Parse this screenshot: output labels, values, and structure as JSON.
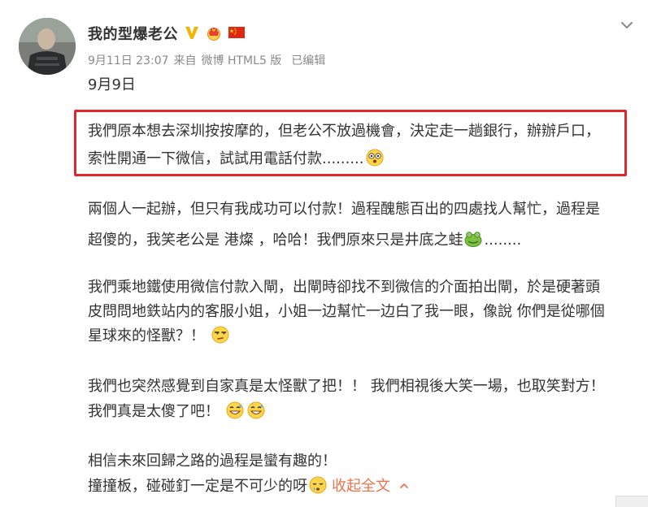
{
  "post": {
    "author": "我的型爆老公",
    "meta": {
      "timestamp": "9月11日 23:07",
      "source_prefix": "来自",
      "source": "微博 HTML5 版",
      "edited": "已编辑"
    },
    "paragraphs": [
      "9月9日",
      "我們原本想去深圳按按摩的，但老公不放過機會，決定走一趟銀行，辦辦戶口，",
      "索性開通一下微信，試試用電話付款.........",
      "兩個人一起辦，但只有我成功可以付款！過程醜態百出的四處找人幫忙，過程是",
      "超傻的，我笑老公是 港燦 ，哈哈！我們原來只是井底之蛙",
      "........",
      "我們乘地鐵使用微信付款入閘，出閘時卻找不到微信的介面拍出閘，於是硬著頭",
      "皮問問地鉄站内的客服小姐，小姐一边幫忙一边白了我一眼，像說 你們是從哪個",
      "星球來的怪獸？！",
      "我們也突然感覺到自家真是太怪獸了把！！ 我們相視後大笑一場，也取笑對方！",
      "我們真是太傻了吧！",
      "相信未來回歸之路的過程是蠻有趣的！",
      "撞撞板，碰碰釘一定是不可少的呀"
    ],
    "collapse_label": "收起全文",
    "icons": {
      "verified": "verified-v-icon",
      "crown": "crown-badge-icon",
      "flag": "china-flag-icon",
      "menu": "chevron-down-icon",
      "collapse": "caret-up-icon"
    },
    "colors": {
      "text": "#333333",
      "meta": "#8a8a8a",
      "highlight_border": "#e0262e",
      "link": "#eb7350",
      "verified": "#f5b400"
    }
  }
}
